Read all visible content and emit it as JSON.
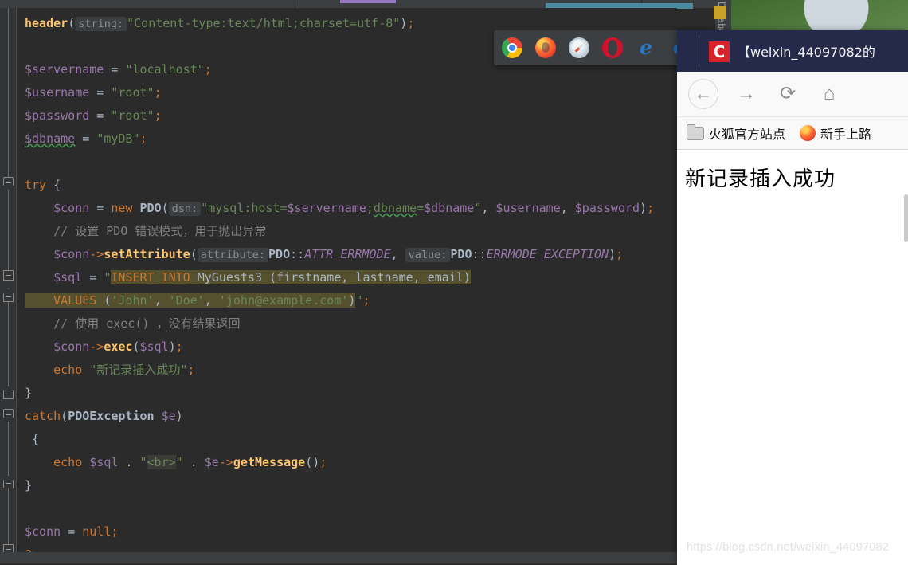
{
  "ide": {
    "gutter_name": "editor-gutter",
    "db_tool_tab_label": "Database",
    "code_lines": [
      {
        "id": "l1",
        "segments": [
          {
            "text": "header",
            "cls": "fn-b"
          },
          {
            "text": "(",
            "cls": "punc"
          },
          {
            "text": "string:",
            "cls": "hint"
          },
          {
            "text": "\"Content-type:text/html;charset=utf-8\"",
            "cls": "str"
          },
          {
            "text": ")",
            "cls": "punc"
          },
          {
            "text": ";",
            "cls": "semi"
          }
        ]
      },
      {
        "id": "l2",
        "segments": []
      },
      {
        "id": "l3",
        "segments": [
          {
            "text": "$servername",
            "cls": "var"
          },
          {
            "text": " = ",
            "cls": "plain"
          },
          {
            "text": "\"localhost\"",
            "cls": "str"
          },
          {
            "text": ";",
            "cls": "semi"
          }
        ]
      },
      {
        "id": "l4",
        "segments": [
          {
            "text": "$username",
            "cls": "var"
          },
          {
            "text": " = ",
            "cls": "plain"
          },
          {
            "text": "\"root\"",
            "cls": "str"
          },
          {
            "text": ";",
            "cls": "semi"
          }
        ]
      },
      {
        "id": "l5",
        "segments": [
          {
            "text": "$password",
            "cls": "var"
          },
          {
            "text": " = ",
            "cls": "plain"
          },
          {
            "text": "\"root\"",
            "cls": "str"
          },
          {
            "text": ";",
            "cls": "semi"
          }
        ]
      },
      {
        "id": "l6",
        "segments": [
          {
            "text": "$dbname",
            "cls": "var squig"
          },
          {
            "text": " = ",
            "cls": "plain"
          },
          {
            "text": "\"myDB\"",
            "cls": "str"
          },
          {
            "text": ";",
            "cls": "semi"
          }
        ]
      },
      {
        "id": "l7",
        "segments": []
      },
      {
        "id": "l8",
        "segments": [
          {
            "text": "try",
            "cls": "kw"
          },
          {
            "text": " {",
            "cls": "punc"
          }
        ]
      },
      {
        "id": "l9",
        "segments": [
          {
            "text": "    ",
            "cls": "plain"
          },
          {
            "text": "$conn",
            "cls": "var"
          },
          {
            "text": " = ",
            "cls": "plain"
          },
          {
            "text": "new",
            "cls": "kw"
          },
          {
            "text": " ",
            "cls": "plain"
          },
          {
            "text": "PDO",
            "cls": "cls"
          },
          {
            "text": "(",
            "cls": "punc"
          },
          {
            "text": "dsn:",
            "cls": "hint"
          },
          {
            "text": "\"mysql:host=",
            "cls": "str"
          },
          {
            "text": "$servername",
            "cls": "var"
          },
          {
            "text": ";",
            "cls": "str"
          },
          {
            "text": "dbname",
            "cls": "str squig"
          },
          {
            "text": "=",
            "cls": "str"
          },
          {
            "text": "$dbname",
            "cls": "var"
          },
          {
            "text": "\"",
            "cls": "str"
          },
          {
            "text": ", ",
            "cls": "punc"
          },
          {
            "text": "$username",
            "cls": "var"
          },
          {
            "text": ", ",
            "cls": "punc"
          },
          {
            "text": "$password",
            "cls": "var"
          },
          {
            "text": ")",
            "cls": "punc"
          },
          {
            "text": ";",
            "cls": "semi"
          }
        ]
      },
      {
        "id": "l10",
        "segments": [
          {
            "text": "    // 设置 PDO 错误模式，用于抛出异常",
            "cls": "cmt"
          }
        ]
      },
      {
        "id": "l11",
        "segments": [
          {
            "text": "    ",
            "cls": "plain"
          },
          {
            "text": "$conn",
            "cls": "var"
          },
          {
            "text": "->",
            "cls": "kw"
          },
          {
            "text": "setAttribute",
            "cls": "fn-b"
          },
          {
            "text": "(",
            "cls": "punc"
          },
          {
            "text": "attribute:",
            "cls": "hint"
          },
          {
            "text": "PDO",
            "cls": "cls"
          },
          {
            "text": "::",
            "cls": "punc"
          },
          {
            "text": "ATTR_ERRMODE",
            "cls": "cnst"
          },
          {
            "text": ", ",
            "cls": "punc"
          },
          {
            "text": "value:",
            "cls": "hint"
          },
          {
            "text": "PDO",
            "cls": "cls"
          },
          {
            "text": "::",
            "cls": "punc"
          },
          {
            "text": "ERRMODE_EXCEPTION",
            "cls": "cnst"
          },
          {
            "text": ")",
            "cls": "punc"
          },
          {
            "text": ";",
            "cls": "semi"
          }
        ]
      },
      {
        "id": "l12",
        "segments": [
          {
            "text": "    ",
            "cls": "plain"
          },
          {
            "text": "$sql",
            "cls": "var"
          },
          {
            "text": " = ",
            "cls": "plain"
          },
          {
            "text": "\"",
            "cls": "str"
          },
          {
            "text": "INSERT INTO",
            "cls": "sqlkw sqlhl"
          },
          {
            "text": " MyGuests3 (firstname, lastname, email)",
            "cls": "sqlid sqlhl"
          }
        ]
      },
      {
        "id": "l13",
        "segments": [
          {
            "text": "    ",
            "cls": "sqlhl"
          },
          {
            "text": "VALUES",
            "cls": "sqlkw sqlhl"
          },
          {
            "text": " (",
            "cls": "sqlid sqlhl"
          },
          {
            "text": "'John'",
            "cls": "sqlstr sqlhl"
          },
          {
            "text": ", ",
            "cls": "sqlid sqlhl"
          },
          {
            "text": "'Doe'",
            "cls": "sqlstr sqlhl"
          },
          {
            "text": ", ",
            "cls": "sqlid sqlhl"
          },
          {
            "text": "'john@example.com'",
            "cls": "sqlstr sqlhl"
          },
          {
            "text": ")",
            "cls": "sqlid sqlhl"
          },
          {
            "text": "\"",
            "cls": "str"
          },
          {
            "text": ";",
            "cls": "semi"
          }
        ]
      },
      {
        "id": "l14",
        "segments": [
          {
            "text": "    // 使用 exec() ，没有结果返回",
            "cls": "cmt"
          }
        ]
      },
      {
        "id": "l15",
        "segments": [
          {
            "text": "    ",
            "cls": "plain"
          },
          {
            "text": "$conn",
            "cls": "var"
          },
          {
            "text": "->",
            "cls": "kw"
          },
          {
            "text": "exec",
            "cls": "fn-b"
          },
          {
            "text": "(",
            "cls": "punc"
          },
          {
            "text": "$sql",
            "cls": "var"
          },
          {
            "text": ")",
            "cls": "punc"
          },
          {
            "text": ";",
            "cls": "semi"
          }
        ]
      },
      {
        "id": "l16",
        "segments": [
          {
            "text": "    ",
            "cls": "plain"
          },
          {
            "text": "echo",
            "cls": "kw"
          },
          {
            "text": " ",
            "cls": "plain"
          },
          {
            "text": "\"新记录插入成功\"",
            "cls": "str"
          },
          {
            "text": ";",
            "cls": "semi"
          }
        ]
      },
      {
        "id": "l17",
        "segments": [
          {
            "text": "}",
            "cls": "punc"
          }
        ]
      },
      {
        "id": "l18",
        "segments": [
          {
            "text": "catch",
            "cls": "kw"
          },
          {
            "text": "(",
            "cls": "punc"
          },
          {
            "text": "PDOException",
            "cls": "cls"
          },
          {
            "text": " ",
            "cls": "plain"
          },
          {
            "text": "$e",
            "cls": "var"
          },
          {
            "text": ")",
            "cls": "punc"
          }
        ]
      },
      {
        "id": "l19",
        "segments": [
          {
            "text": " {",
            "cls": "punc"
          }
        ]
      },
      {
        "id": "l20",
        "segments": [
          {
            "text": "    ",
            "cls": "plain"
          },
          {
            "text": "echo",
            "cls": "kw"
          },
          {
            "text": " ",
            "cls": "plain"
          },
          {
            "text": "$sql",
            "cls": "var"
          },
          {
            "text": " . ",
            "cls": "punc"
          },
          {
            "text": "\"",
            "cls": "str"
          },
          {
            "text": "<br>",
            "cls": "str brhl"
          },
          {
            "text": "\"",
            "cls": "str"
          },
          {
            "text": " . ",
            "cls": "punc"
          },
          {
            "text": "$e",
            "cls": "var"
          },
          {
            "text": "->",
            "cls": "kw"
          },
          {
            "text": "getMessage",
            "cls": "fn-b"
          },
          {
            "text": "()",
            "cls": "punc"
          },
          {
            "text": ";",
            "cls": "semi"
          }
        ]
      },
      {
        "id": "l21",
        "segments": [
          {
            "text": "}",
            "cls": "punc"
          }
        ]
      },
      {
        "id": "l22",
        "segments": []
      },
      {
        "id": "l23",
        "segments": [
          {
            "text": "$conn",
            "cls": "var"
          },
          {
            "text": " = ",
            "cls": "plain"
          },
          {
            "text": "null",
            "cls": "kw"
          },
          {
            "text": ";",
            "cls": "semi"
          }
        ]
      },
      {
        "id": "l24",
        "segments": [
          {
            "text": "?>",
            "cls": "kw squig-warn"
          }
        ]
      }
    ]
  },
  "browser_launcher": {
    "name": "browser-launcher-popup",
    "icons": [
      {
        "name": "chrome-icon",
        "label": "Chrome",
        "cls": "ico-chrome",
        "glyph": ""
      },
      {
        "name": "firefox-icon",
        "label": "Firefox",
        "cls": "ico-firefox",
        "glyph": ""
      },
      {
        "name": "safari-icon",
        "label": "Safari",
        "cls": "ico-safari",
        "glyph": ""
      },
      {
        "name": "opera-icon",
        "label": "Opera",
        "cls": "ico-opera",
        "glyph": ""
      },
      {
        "name": "edge-icon",
        "label": "Edge",
        "cls": "ico-edge",
        "glyph": "e"
      },
      {
        "name": "internet-explorer-icon",
        "label": "Internet Explorer",
        "cls": "ico-ie",
        "glyph": "e"
      }
    ]
  },
  "browser": {
    "tab_title": "【weixin_44097082的",
    "favicon_letter": "C",
    "nav": {
      "back_icon": "←",
      "forward_icon": "→",
      "reload_icon": "⟳",
      "home_icon": "⌂"
    },
    "bookmarks": [
      {
        "name": "bookmark-firefox-official-site",
        "label": "火狐官方站点",
        "icon": "folder-icon"
      },
      {
        "name": "bookmark-getting-started",
        "label": "新手上路",
        "icon": "firefox-icon"
      }
    ],
    "page_text": "新记录插入成功"
  },
  "watermark": {
    "text": "https://blog.csdn.net/weixin_44097082"
  },
  "colors": {
    "editor_bg": "#2b2b2b",
    "gutter_bg": "#313335",
    "chrome_bg": "#3c3f41",
    "sql_highlight": "#55502e",
    "browser_titlebar": "#262a4a",
    "favicon_red": "#d8232a",
    "db_marker": "#c9a227"
  }
}
